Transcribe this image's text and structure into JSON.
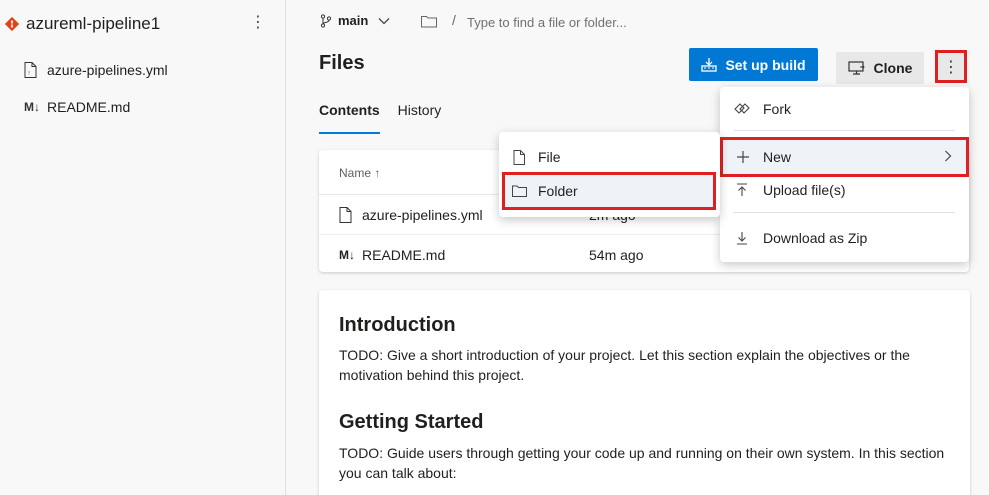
{
  "sidebar": {
    "repo_name": "azureml-pipeline1",
    "more_label": "⋮",
    "files": [
      {
        "name": "azure-pipelines.yml",
        "icon": "yaml-file-icon"
      },
      {
        "name": "README.md",
        "icon": "markdown-file-icon"
      }
    ]
  },
  "topbar": {
    "branch": "main",
    "slash": "/",
    "path_placeholder": "Type to find a file or folder..."
  },
  "page": {
    "title": "Files",
    "build_button": "Set up build",
    "clone_button": "Clone",
    "more_label": "⋮"
  },
  "tabs": [
    {
      "label": "Contents",
      "active": true
    },
    {
      "label": "History",
      "active": false
    }
  ],
  "table": {
    "header_name": "Name ↑",
    "rows": [
      {
        "name": "azure-pipelines.yml",
        "time": "2m ago"
      },
      {
        "name": "README.md",
        "time": "54m ago"
      }
    ]
  },
  "readme": {
    "h1": "Introduction",
    "p1": "TODO: Give a short introduction of your project. Let this section explain the objectives or the motivation behind this project.",
    "h2": "Getting Started",
    "p2": "TODO: Guide users through getting your code up and running on their own system. In this section you can talk about:"
  },
  "more_menu": {
    "fork": "Fork",
    "new": "New",
    "upload": "Upload file(s)",
    "download": "Download as Zip"
  },
  "new_menu": {
    "file": "File",
    "folder": "Folder"
  },
  "colors": {
    "accent": "#0078d4",
    "highlight_box": "#e02020",
    "repo_icon": "#e0421a"
  }
}
